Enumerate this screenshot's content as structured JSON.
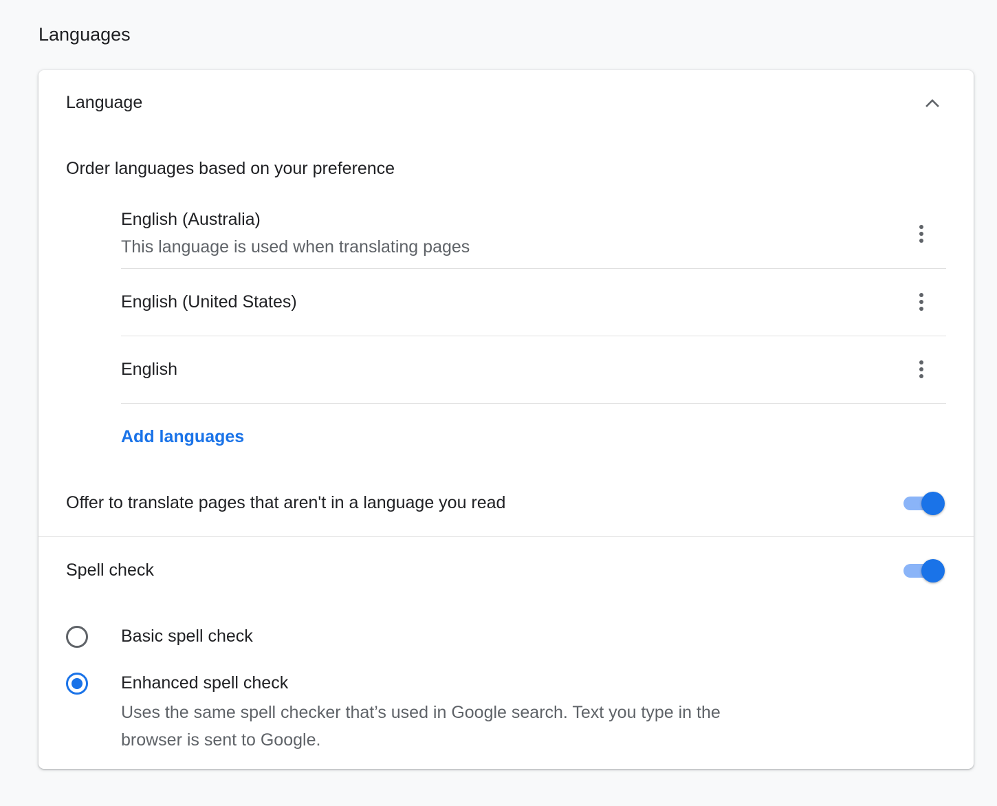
{
  "page": {
    "section_title": "Languages"
  },
  "language": {
    "header": "Language",
    "order_label": "Order languages based on your preference",
    "items": [
      {
        "name": "English (Australia)",
        "subtitle": "This language is used when translating pages"
      },
      {
        "name": "English (United States)"
      },
      {
        "name": "English"
      }
    ],
    "add_languages": "Add languages",
    "translate_offer_label": "Offer to translate pages that aren't in a language you read",
    "translate_offer_enabled": true
  },
  "spell_check": {
    "label": "Spell check",
    "enabled": true,
    "options": [
      {
        "label": "Basic spell check",
        "selected": false
      },
      {
        "label": "Enhanced spell check",
        "selected": true,
        "description": "Uses the same spell checker that’s used in Google search. Text you type in the browser is sent to Google."
      }
    ]
  },
  "colors": {
    "accent": "#1a73e8",
    "toggle_track": "#8ab4f8",
    "primary_text": "#202124",
    "secondary_text": "#5f6368",
    "background": "#f8f9fa"
  },
  "icons": {
    "collapse": "chevron-up-icon",
    "menu": "more-vert-icon"
  }
}
